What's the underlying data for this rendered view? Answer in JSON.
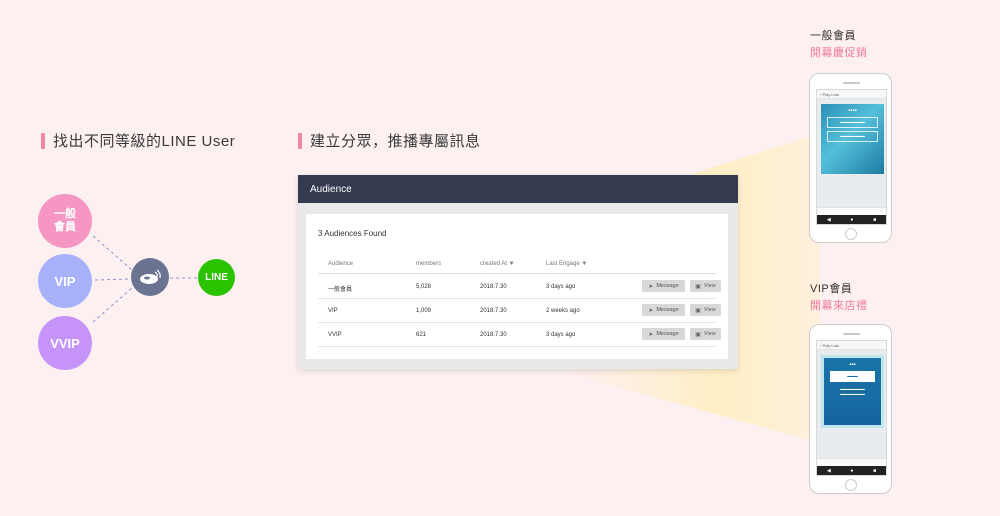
{
  "left_section": {
    "heading": "找出不同等級的LINE User",
    "tiers": {
      "general": "一般\n會員",
      "vip": "VIP",
      "vvip": "VVIP"
    },
    "line_label": "LINE"
  },
  "middle_section": {
    "heading": "建立分眾，推播專屬訊息"
  },
  "panel": {
    "title": "Audience",
    "found_text": "3 Audiences Found",
    "columns": [
      "Audience",
      "members",
      "created At ▼",
      "Last Engage ▼"
    ],
    "rows": [
      {
        "audience": "一般會員",
        "members": "5,028",
        "created": "2018.7.30",
        "last_engage": "3 days ago"
      },
      {
        "audience": "VIP",
        "members": "1,009",
        "created": "2018.7.30",
        "last_engage": "2 weeks ago"
      },
      {
        "audience": "VVIP",
        "members": "621",
        "created": "2018.7.30",
        "last_engage": "3 days ago"
      }
    ],
    "message_label": "Message",
    "view_label": "View"
  },
  "phone1": {
    "label_line1": "一般會員",
    "label_line2": "開幕慶促銷",
    "chat_title": "Poly Lulu"
  },
  "phone2": {
    "label_line1": "VIP會員",
    "label_line2": "開幕來店禮",
    "chat_title": "Poly Lulu"
  },
  "colors": {
    "pink_accent": "#f087a8",
    "general_circle": "#f596c3",
    "vip_circle": "#a8b2fb",
    "vvip_circle": "#c694f8",
    "hub_circle": "#6a7390",
    "line_green": "#2bc200",
    "panel_header": "#343a4f"
  }
}
